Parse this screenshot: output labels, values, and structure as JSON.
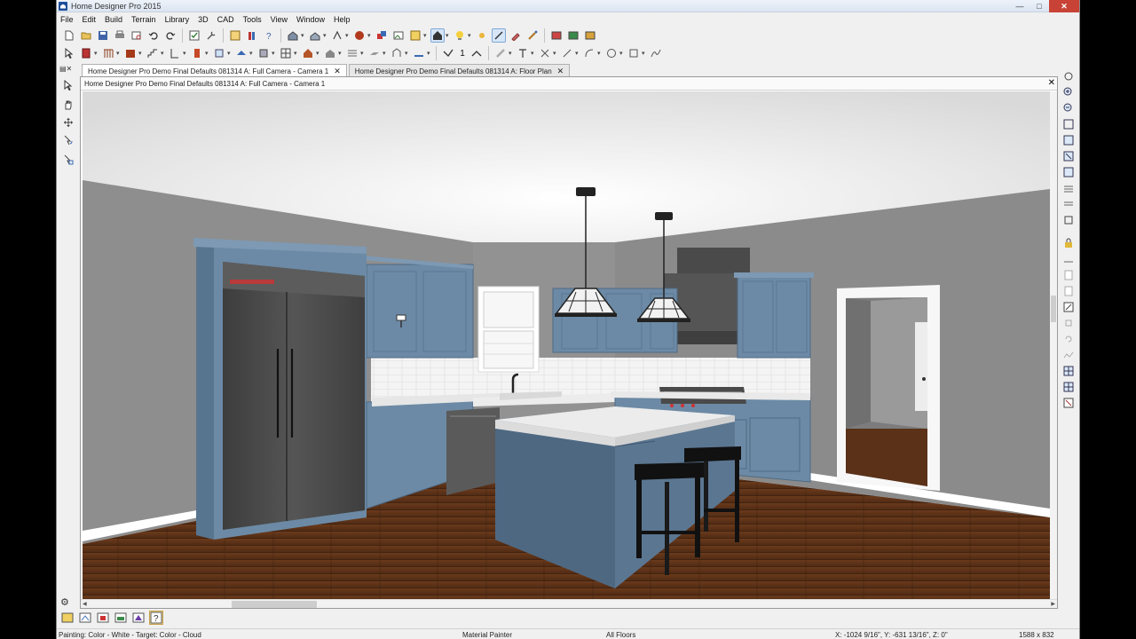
{
  "window": {
    "title": "Home Designer Pro 2015"
  },
  "menu": [
    "File",
    "Edit",
    "Build",
    "Terrain",
    "Library",
    "3D",
    "CAD",
    "Tools",
    "View",
    "Window",
    "Help"
  ],
  "toolbar2": {
    "count_label": "1"
  },
  "tabs": [
    {
      "label": "Home Designer Pro Demo Final Defaults 081314 A: Full Camera - Camera 1",
      "active": true
    },
    {
      "label": "Home Designer Pro Demo Final Defaults 081314 A: Floor Plan",
      "active": false
    }
  ],
  "doc": {
    "title": "Home Designer Pro Demo Final Defaults 081314 A: Full Camera - Camera 1"
  },
  "status": {
    "message": "Painting: Color - White - Target: Color - Cloud",
    "mode": "Material Painter",
    "floors": "All Floors",
    "coords": "X: -1024 9/16\", Y: -631 13/16\", Z: 0\"",
    "size": "1588 x 832"
  },
  "colors": {
    "cabinet": "#6c8aa5",
    "wall": "#8c8c8c",
    "ceiling": "#efefef",
    "floor": "#5b3118",
    "fridge": "#4a4a4a",
    "trim": "#ffffff"
  }
}
